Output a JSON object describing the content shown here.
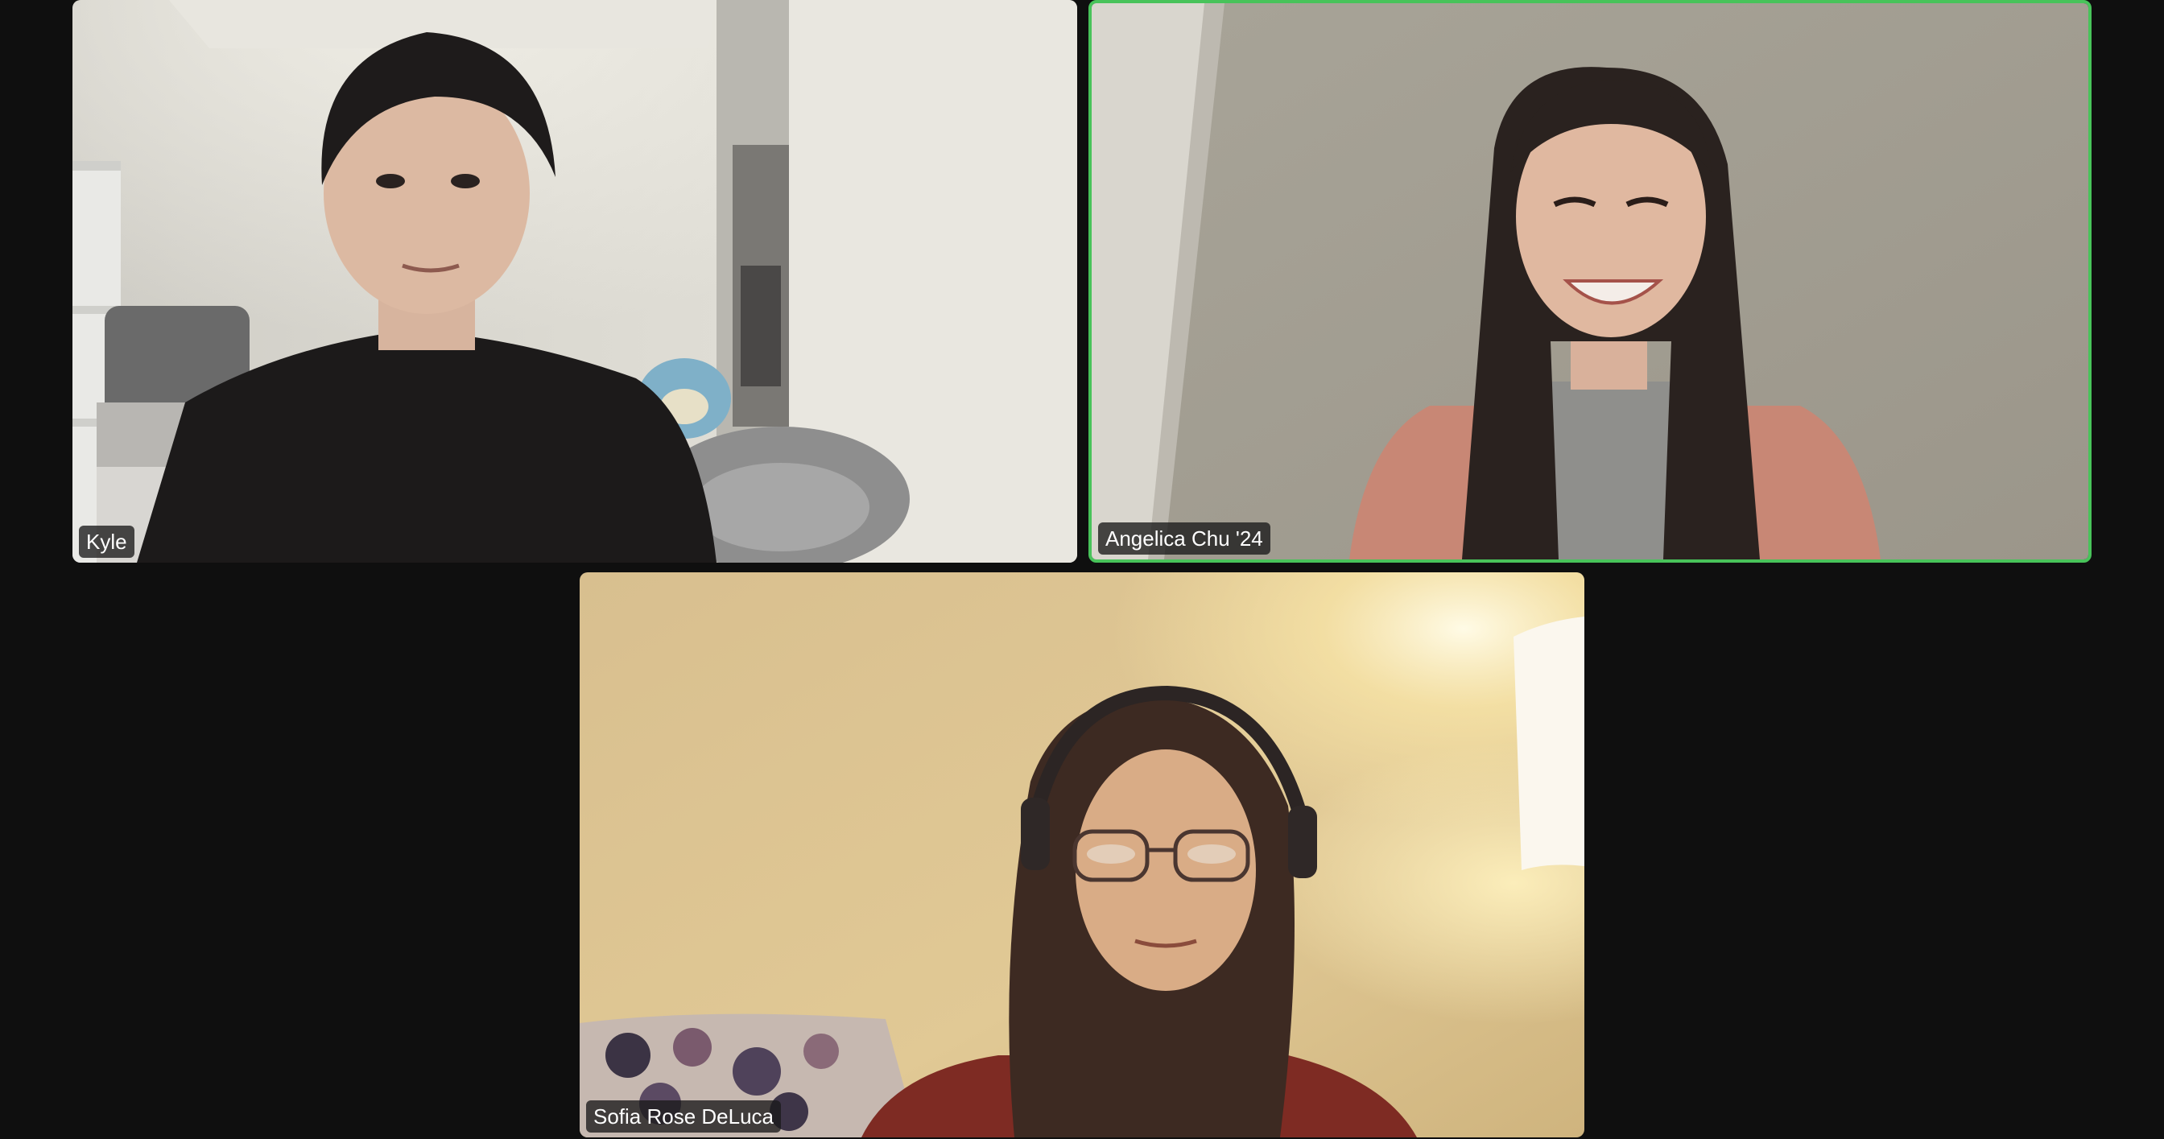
{
  "meeting": {
    "view": "gallery",
    "participants": [
      {
        "name": "Kyle",
        "active_speaker": false
      },
      {
        "name": "Angelica Chu '24",
        "active_speaker": true
      },
      {
        "name": "Sofia Rose DeLuca",
        "active_speaker": false
      }
    ]
  },
  "colors": {
    "background": "#0f0f0f",
    "active_speaker_border": "#48c35a",
    "name_tag_bg": "#1a1a1a",
    "name_tag_text": "#ffffff"
  }
}
